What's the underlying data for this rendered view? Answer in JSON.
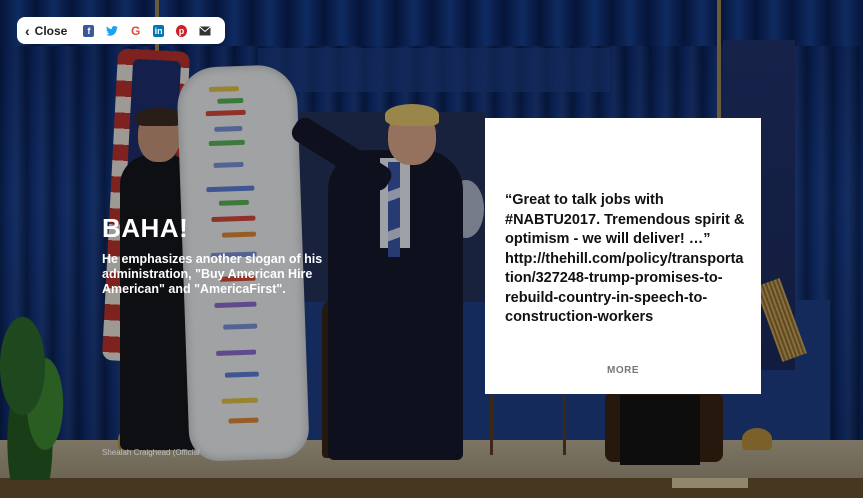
{
  "toolbar": {
    "close_label": "Close",
    "share_icons": [
      "facebook-icon",
      "twitter-icon",
      "google-icon",
      "linkedin-icon",
      "pinterest-icon",
      "email-icon"
    ]
  },
  "slide": {
    "title": "BAHA!",
    "description": "He emphasizes another slogan of his administration, \"Buy American Hire American\" and \"AmericaFirst\".",
    "photo_credit": "Shealah Craighead (Official"
  },
  "quote_card": {
    "text": "“Great to talk jobs with #NABTU2017. Tremendous spirit & optimism - we will deliver! …” http://thehill.com/policy/transportation/327248-trump-promises-to-rebuild-country-in-speech-to-construction-workers",
    "more_label": "MORE"
  },
  "colors": {
    "facebook": "#3b5998",
    "twitter": "#1da1f2",
    "google": "#dd4b39",
    "linkedin": "#0077b5",
    "pinterest": "#cb2027"
  }
}
